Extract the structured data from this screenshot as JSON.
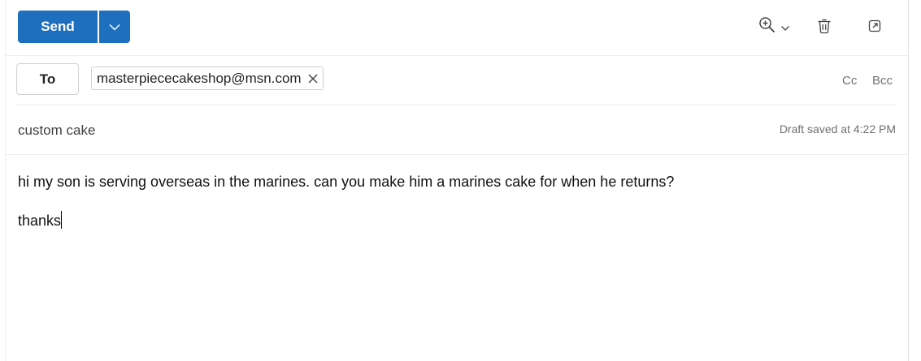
{
  "toolbar": {
    "send_label": "Send",
    "icons": [
      "send-options-chevron-icon",
      "zoom-icon",
      "chevron-down-icon",
      "trash-icon",
      "popout-icon"
    ]
  },
  "recipients": {
    "to_label": "To",
    "to": [
      "masterpiececakeshop@msn.com"
    ],
    "cc_label": "Cc",
    "bcc_label": "Bcc"
  },
  "subject": {
    "value": "custom cake",
    "draft_status": "Draft saved at 4:22 PM"
  },
  "body": {
    "lines": [
      "hi my son is serving overseas in the marines.  can you make him a marines cake for when he returns?",
      "thanks"
    ]
  },
  "colors": {
    "accent": "#1f6fbf",
    "muted_text": "#707070",
    "border": "#d1d1d1"
  }
}
